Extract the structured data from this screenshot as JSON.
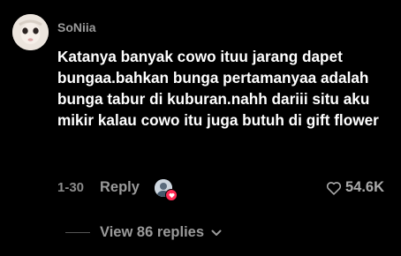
{
  "comment": {
    "username": "SoNiia",
    "text": "Katanya banyak cowo ituu jarang dapet bungaa.bahkan bunga pertamanyaa adalah bunga tabur di kuburan.nahh dariii situ aku mikir kalau cowo itu juga butuh di gift flower",
    "date": "1-30",
    "reply_label": "Reply",
    "likes": "54.6K",
    "view_replies_label": "View 86 replies"
  },
  "colors": {
    "background": "#000000",
    "muted_text": "#9a9a9a",
    "badge": "#ff2c55"
  },
  "icons": [
    "avatar",
    "creator-liked-avatar",
    "heart-badge-icon",
    "heart-outline-icon",
    "chevron-down-icon"
  ]
}
